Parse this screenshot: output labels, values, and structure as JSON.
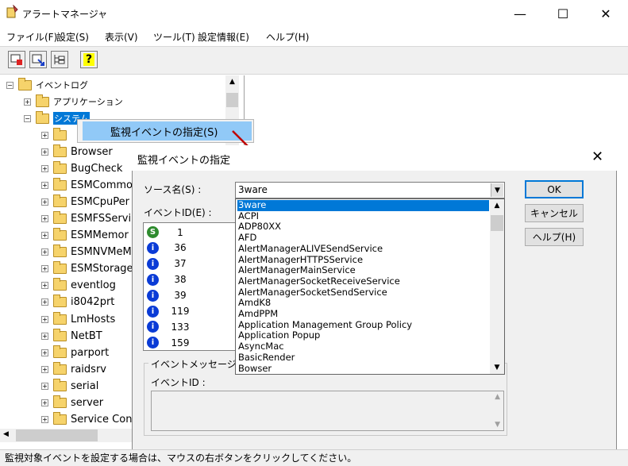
{
  "window": {
    "title": "アラートマネージャ",
    "minimize": "—",
    "maximize": "☐",
    "close": "✕"
  },
  "menu": [
    "ファイル(F)",
    "設定(S)",
    "表示(V)",
    "ツール(T)",
    "設定情報(E)",
    "ヘルプ(H)"
  ],
  "toolbar": {
    "help_glyph": "?"
  },
  "tree": {
    "root": "イベントログ",
    "application": "アプリケーション",
    "system": "システム",
    "items": [
      "Browser",
      "BugCheck",
      "ESMCommo",
      "ESMCpuPer",
      "ESMFSServi",
      "ESMMemor",
      "ESMNVMeM",
      "ESMStorage",
      "eventlog",
      "i8042prt",
      "LmHosts",
      "NetBT",
      "parport",
      "raidsrv",
      "serial",
      "server",
      "Service Con"
    ]
  },
  "context_menu": {
    "item": "監視イベントの指定(S)"
  },
  "dialog": {
    "title": "監視イベントの指定",
    "close": "✕",
    "source_label": "ソース名(S) :",
    "source_value": "3ware",
    "event_id_label": "イベントID(E) :",
    "ok": "OK",
    "cancel": "キャンセル",
    "help": "ヘルプ(H)",
    "message_group_label": "イベントメッセージ(V)",
    "message_event_id_label": "イベントID :",
    "sources": [
      "3ware",
      "ACPI",
      "ADP80XX",
      "AFD",
      "AlertManagerALIVESendService",
      "AlertManagerHTTPSService",
      "AlertManagerMainService",
      "AlertManagerSocketReceiveService",
      "AlertManagerSocketSendService",
      "AmdK8",
      "AmdPPM",
      "Application Management Group Policy",
      "Application Popup",
      "AsyncMac",
      "BasicRender",
      "Bowser"
    ],
    "events": [
      {
        "icon": "S",
        "id": "1",
        "color": "#2e8b2e"
      },
      {
        "icon": "i",
        "id": "36",
        "color": "#0a3bd6"
      },
      {
        "icon": "i",
        "id": "37",
        "color": "#0a3bd6"
      },
      {
        "icon": "i",
        "id": "38",
        "color": "#0a3bd6"
      },
      {
        "icon": "i",
        "id": "39",
        "color": "#0a3bd6"
      },
      {
        "icon": "i",
        "id": "119",
        "color": "#0a3bd6"
      },
      {
        "icon": "i",
        "id": "133",
        "color": "#0a3bd6"
      },
      {
        "icon": "i",
        "id": "159",
        "color": "#0a3bd6"
      }
    ]
  },
  "status": {
    "text": "監視対象イベントを設定する場合は、マウスの右ボタンをクリックしてください。"
  },
  "colors": {
    "selection": "#0078d7",
    "context_highlight": "#91c9f7",
    "arrow": "#c00000"
  }
}
